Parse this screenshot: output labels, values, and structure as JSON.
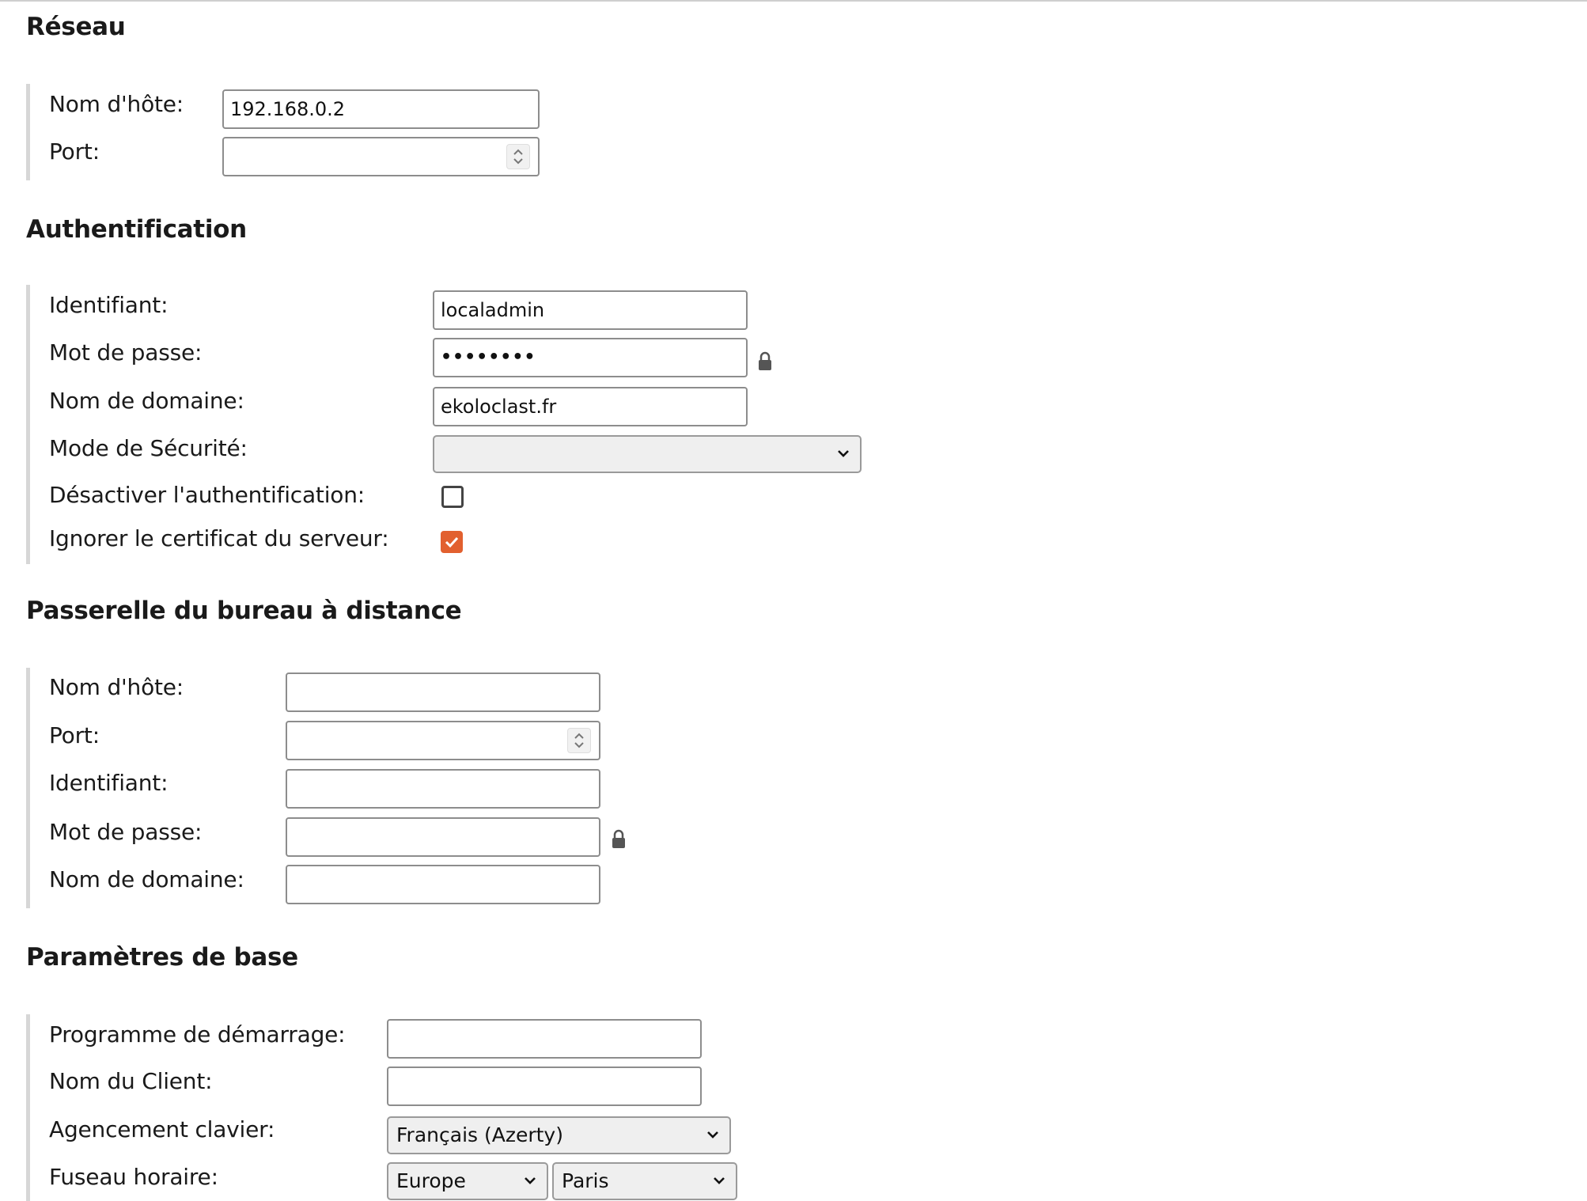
{
  "sections": {
    "network": {
      "title": "Réseau",
      "hostname_label": "Nom d'hôte:",
      "hostname_value": "192.168.0.2",
      "port_label": "Port:",
      "port_value": ""
    },
    "auth": {
      "title": "Authentification",
      "username_label": "Identifiant:",
      "username_value": "localadmin",
      "password_label": "Mot de passe:",
      "password_value": "••••••••",
      "domain_label": "Nom de domaine:",
      "domain_value": "ekoloclast.fr",
      "security_mode_label": "Mode de Sécurité:",
      "security_mode_value": "",
      "disable_auth_label": "Désactiver l'authentification:",
      "disable_auth_checked": false,
      "ignore_cert_label": "Ignorer le certificat du serveur:",
      "ignore_cert_checked": true
    },
    "gateway": {
      "title": "Passerelle du bureau à distance",
      "hostname_label": "Nom d'hôte:",
      "hostname_value": "",
      "port_label": "Port:",
      "port_value": "",
      "username_label": "Identifiant:",
      "username_value": "",
      "password_label": "Mot de passe:",
      "password_value": "",
      "domain_label": "Nom de domaine:",
      "domain_value": ""
    },
    "basic": {
      "title": "Paramètres de base",
      "startup_program_label": "Programme de démarrage:",
      "startup_program_value": "",
      "client_name_label": "Nom du Client:",
      "client_name_value": "",
      "keyboard_label": "Agencement clavier:",
      "keyboard_value": "Français (Azerty)",
      "timezone_label": "Fuseau horaire:",
      "timezone_region": "Europe",
      "timezone_city": "Paris"
    }
  },
  "icons": {
    "lock": "lock-icon",
    "chevron": "chevron-down-icon",
    "spinner": "spinner-icon",
    "check": "checkmark-icon"
  },
  "colors": {
    "checkbox_checked": "#e2602f",
    "fieldset_border": "#d7d7d7",
    "select_bg": "#efefef"
  }
}
